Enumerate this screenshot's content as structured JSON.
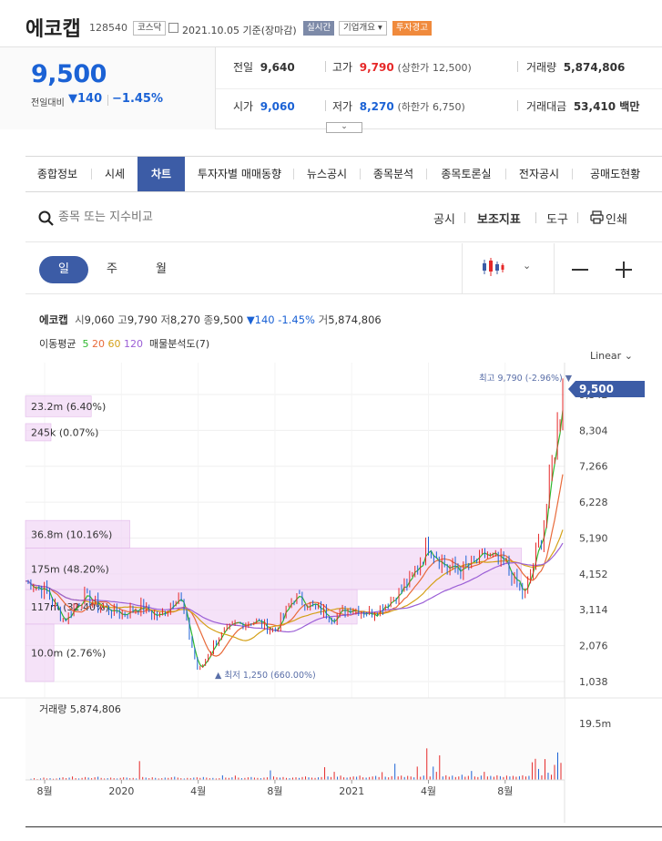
{
  "header": {
    "name": "에코캡",
    "code": "128540",
    "market": "코스닥",
    "date": "2021.10.05 기준(장마감)",
    "realtime": "실시간",
    "company_info": "기업개요 ▾",
    "warning": "투자경고"
  },
  "quote": {
    "price": "9,500",
    "change_label": "전일대비",
    "change_value": "▼140",
    "change_pct": "−1.45%",
    "prev_close_label": "전일",
    "prev_close": "9,640",
    "high_label": "고가",
    "high": "9,790",
    "upper_limit_label": "(상한가",
    "upper_limit": "12,500)",
    "volume_label": "거래량",
    "volume": "5,874,806",
    "open_label": "시가",
    "open": "9,060",
    "low_label": "저가",
    "low": "8,270",
    "lower_limit_label": "(하한가",
    "lower_limit": "6,750)",
    "amount_label": "거래대금",
    "amount": "53,410 백만"
  },
  "tabs": [
    "종합정보",
    "시세",
    "차트",
    "투자자별 매매동향",
    "뉴스공시",
    "종목분석",
    "종목토론실",
    "전자공시",
    "공매도현황"
  ],
  "toolbar": {
    "search_placeholder": "종목 또는 지수비교",
    "disclosure": "공시",
    "indicator": "보조지표",
    "tools": "도구",
    "print": "인쇄"
  },
  "period": {
    "day": "일",
    "week": "주",
    "month": "월"
  },
  "info": {
    "name": "에코캡",
    "o_label": "시",
    "o": "9,060",
    "h_label": "고",
    "h": "9,790",
    "l_label": "저",
    "l": "8,270",
    "c_label": "종",
    "c": "9,500",
    "chg": "▼140",
    "pct": "-1.45%",
    "v_label": "거",
    "v": "5,874,806",
    "ma_label": "이동평균",
    "ma5": "5",
    "ma20": "20",
    "ma60": "60",
    "ma120": "120",
    "vp_label": "매물분석도(7)",
    "scale": "Linear"
  },
  "colors": {
    "up": "#e62828",
    "down": "#1b62d5",
    "accent": "#3c5ca6",
    "ma5": "#2eb82e",
    "ma20": "#e86a3a",
    "ma60": "#d4a017",
    "ma120": "#9b5fd6",
    "vp": "#f2d8f5"
  },
  "chart_data": {
    "type": "line",
    "title": "",
    "yscale": "linear",
    "ylim": [
      1038,
      9790
    ],
    "yticks": [
      9342,
      8304,
      7266,
      6228,
      5190,
      4152,
      3114,
      2076,
      1038
    ],
    "ytick_labels": [
      "9,342",
      "8,304",
      "7,266",
      "6,228",
      "5,190",
      "4,152",
      "3,114",
      "2,076",
      "1,038"
    ],
    "x_labels": [
      "8월",
      "2020",
      "4월",
      "8월",
      "2021",
      "4월",
      "8월"
    ],
    "x_label_index": [
      1,
      5,
      9,
      13,
      17,
      21,
      25
    ],
    "series": [
      {
        "name": "",
        "x_index": [
          0,
          1,
          2,
          3,
          4,
          5,
          6,
          7,
          8,
          9,
          10,
          11,
          12,
          13,
          14,
          15,
          16,
          17,
          18,
          19,
          20,
          21,
          22,
          23,
          24,
          25,
          26,
          27,
          28
        ],
        "values": [
          3950,
          3700,
          2800,
          3500,
          3200,
          3000,
          3200,
          2900,
          3600,
          1300,
          2300,
          2700,
          2800,
          2500,
          3500,
          3200,
          2900,
          3200,
          3000,
          3400,
          3900,
          5000,
          4300,
          4300,
          4700,
          4400,
          3500,
          5500,
          9500
        ]
      }
    ],
    "current_price": "9,500",
    "high_annotation": "최고 9,790 (-2.96%) ▼",
    "low_annotation": "▲ 최저 1,250 (660.00%)",
    "volume_profile": [
      {
        "label": "23.2m (6.40%)",
        "price_low": 8700,
        "price_high": 9300,
        "value": 23.2
      },
      {
        "label": "245k (0.07%)",
        "price_low": 8000,
        "price_high": 8500,
        "value": 0.245
      },
      {
        "label": "36.8m (10.16%)",
        "price_low": 4900,
        "price_high": 5700,
        "value": 36.8
      },
      {
        "label": "175m (48.20%)",
        "price_low": 3700,
        "price_high": 4900,
        "value": 175
      },
      {
        "label": "117m (32.40%)",
        "price_low": 2700,
        "price_high": 3700,
        "value": 117
      },
      {
        "label": "10.0m (2.76%)",
        "price_low": 1038,
        "price_high": 2700,
        "value": 10.0
      }
    ],
    "volume_label": "거래량 5,874,806",
    "volume_max_label": "19.5m",
    "volume_max": 19.5,
    "volume_values": [
      0.4,
      0.6,
      0.3,
      0.5,
      0.8,
      0.5,
      0.6,
      0.4,
      0.5,
      0.7,
      0.9,
      0.6,
      0.8,
      1.2,
      0.6,
      0.5,
      0.7,
      1.0,
      0.8,
      0.6,
      0.9,
      1.1,
      0.7,
      0.5,
      0.6,
      0.8,
      0.6,
      0.5,
      0.7,
      0.9,
      0.8,
      0.6,
      0.7,
      0.5,
      6.5,
      1.0,
      0.8,
      0.6,
      0.9,
      0.7,
      0.5,
      0.6,
      0.8,
      0.7,
      0.9,
      1.1,
      0.8,
      0.6,
      0.5,
      0.7,
      0.6,
      0.8,
      0.9,
      0.7,
      1.0,
      0.8,
      0.6,
      0.7,
      0.5,
      0.6,
      1.6,
      0.8,
      0.7,
      0.9,
      1.5,
      0.8,
      0.6,
      0.7,
      0.9,
      1.0,
      0.8,
      0.7,
      0.6,
      0.8,
      0.9,
      3.3,
      1.2,
      0.9,
      0.8,
      1.0,
      0.7,
      0.6,
      0.8,
      0.9,
      0.7,
      1.0,
      1.2,
      0.9,
      0.8,
      0.7,
      0.9,
      1.0,
      4.4,
      1.2,
      1.0,
      2.8,
      1.1,
      1.5,
      0.9,
      0.8,
      1.0,
      1.2,
      1.1,
      1.5,
      0.9,
      0.8,
      1.0,
      1.2,
      1.4,
      1.0,
      2.7,
      1.1,
      0.9,
      1.3,
      5.6,
      1.2,
      1.5,
      1.0,
      1.4,
      1.2,
      0.9,
      4.6,
      1.1,
      1.5,
      10.9,
      1.2,
      4.6,
      2.8,
      8.5,
      1.2,
      1.6,
      1.1,
      1.5,
      1.0,
      1.2,
      1.8,
      1.1,
      1.4,
      3.1,
      1.2,
      1.0,
      1.5,
      2.8,
      1.2,
      1.4,
      1.1,
      1.6,
      1.3,
      1.0,
      1.5,
      1.2,
      1.4,
      1.1,
      1.3,
      1.6,
      1.2,
      1.4,
      6.1,
      7.3,
      3.8,
      1.6,
      7.2,
      2.5,
      1.8,
      5.2,
      9.5,
      5.9
    ]
  }
}
